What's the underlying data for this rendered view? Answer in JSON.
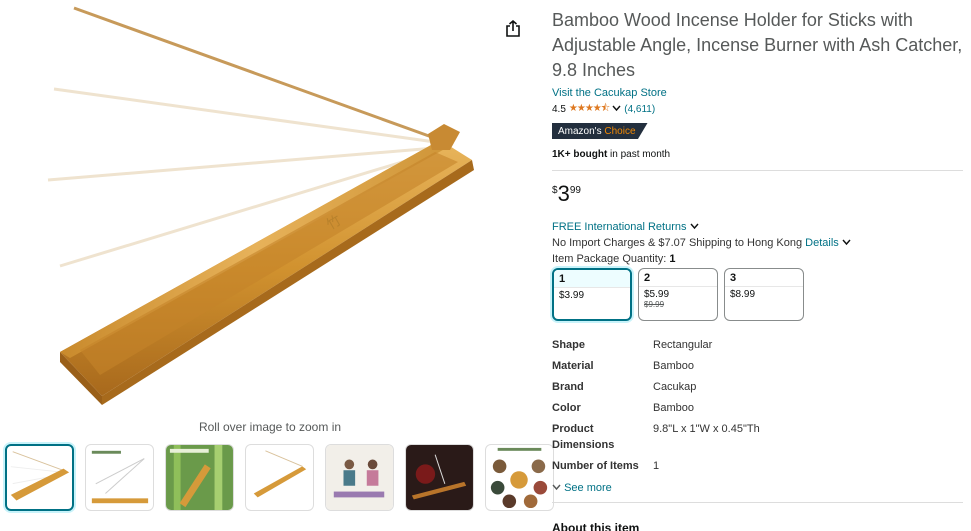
{
  "product": {
    "title": "Bamboo Wood Incense Holder for Sticks with Adjustable Angle, Incense Burner with Ash Catcher, 9.8 Inches",
    "store_link": "Visit the Cacukap Store",
    "rating_value": "4.5",
    "stars": "★★★★⯪",
    "rating_count": "(4,611)",
    "badge_prefix": "Amazon's",
    "badge_accent": "Choice",
    "bought_bold": "1K+ bought",
    "bought_rest": " in past month",
    "price_symbol": "$",
    "price_whole": "3",
    "price_fraction": "99",
    "returns": "FREE International Returns",
    "import_text": "No Import Charges & $7.07 Shipping to Hong Kong",
    "import_details": "Details",
    "package_label": "Item Package Quantity:",
    "package_value": "1"
  },
  "quantity_options": [
    {
      "qty": "1",
      "price": "$3.99",
      "old_price": ""
    },
    {
      "qty": "2",
      "price": "$5.99",
      "old_price": "$9.99"
    },
    {
      "qty": "3",
      "price": "$8.99",
      "old_price": ""
    }
  ],
  "specs": [
    {
      "key": "Shape",
      "value": "Rectangular"
    },
    {
      "key": "Material",
      "value": "Bamboo"
    },
    {
      "key": "Brand",
      "value": "Cacukap"
    },
    {
      "key": "Color",
      "value": "Bamboo"
    },
    {
      "key": "Product Dimensions",
      "value": "9.8\"L x 1\"W x 0.45\"Th"
    },
    {
      "key": "Number of Items",
      "value": "1"
    }
  ],
  "see_more": "See more",
  "about": "About this item",
  "zoom_hint": "Roll over image to zoom in",
  "thumbnails": [
    {
      "name": "holder-angles",
      "caption": ""
    },
    {
      "name": "dimensions",
      "caption": ""
    },
    {
      "name": "bamboo-material",
      "caption": ""
    },
    {
      "name": "holder-single",
      "caption": ""
    },
    {
      "name": "yoga-scene",
      "caption": ""
    },
    {
      "name": "lifestyle-dark",
      "caption": ""
    },
    {
      "name": "applicable-scenes",
      "caption": ""
    }
  ],
  "colors": {
    "link": "#007185",
    "star": "#de7921",
    "badge_bg": "#232f3e",
    "badge_accent": "#f08804",
    "bamboo": "#d69a3a"
  },
  "icons": {
    "share": "share-icon",
    "chevron": "chevron-down-icon"
  }
}
